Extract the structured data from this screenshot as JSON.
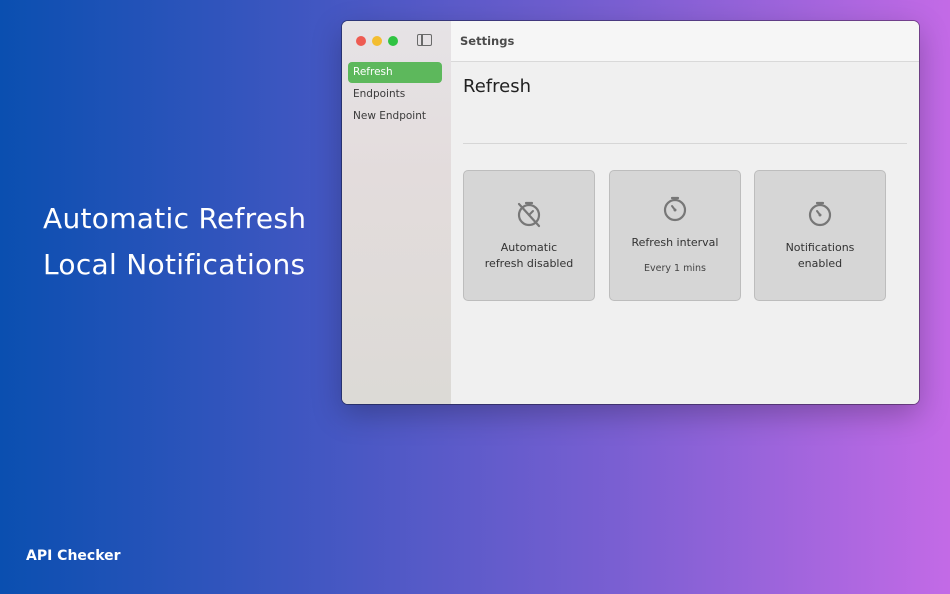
{
  "promo": {
    "lines": [
      "Automatic Refresh",
      "Local Notifications"
    ],
    "brand": "API Checker"
  },
  "window": {
    "title": "Settings",
    "sidebar": {
      "items": [
        {
          "label": "Refresh",
          "active": true
        },
        {
          "label": "Endpoints",
          "active": false
        },
        {
          "label": "New Endpoint",
          "active": false
        }
      ]
    },
    "main": {
      "heading": "Refresh",
      "cards": [
        {
          "label_line1": "Automatic",
          "label_line2": "refresh disabled",
          "icon": "timer-off-icon"
        },
        {
          "label": "Refresh interval",
          "sublabel": "Every 1 mins",
          "icon": "timer-icon"
        },
        {
          "label_line1": "Notifications",
          "label_line2": "enabled",
          "icon": "timer-icon"
        }
      ]
    }
  },
  "colors": {
    "accent_green": "#5db85c",
    "traffic_red": "#ee5b52",
    "traffic_yellow": "#f3bd30",
    "traffic_green": "#30c342"
  }
}
